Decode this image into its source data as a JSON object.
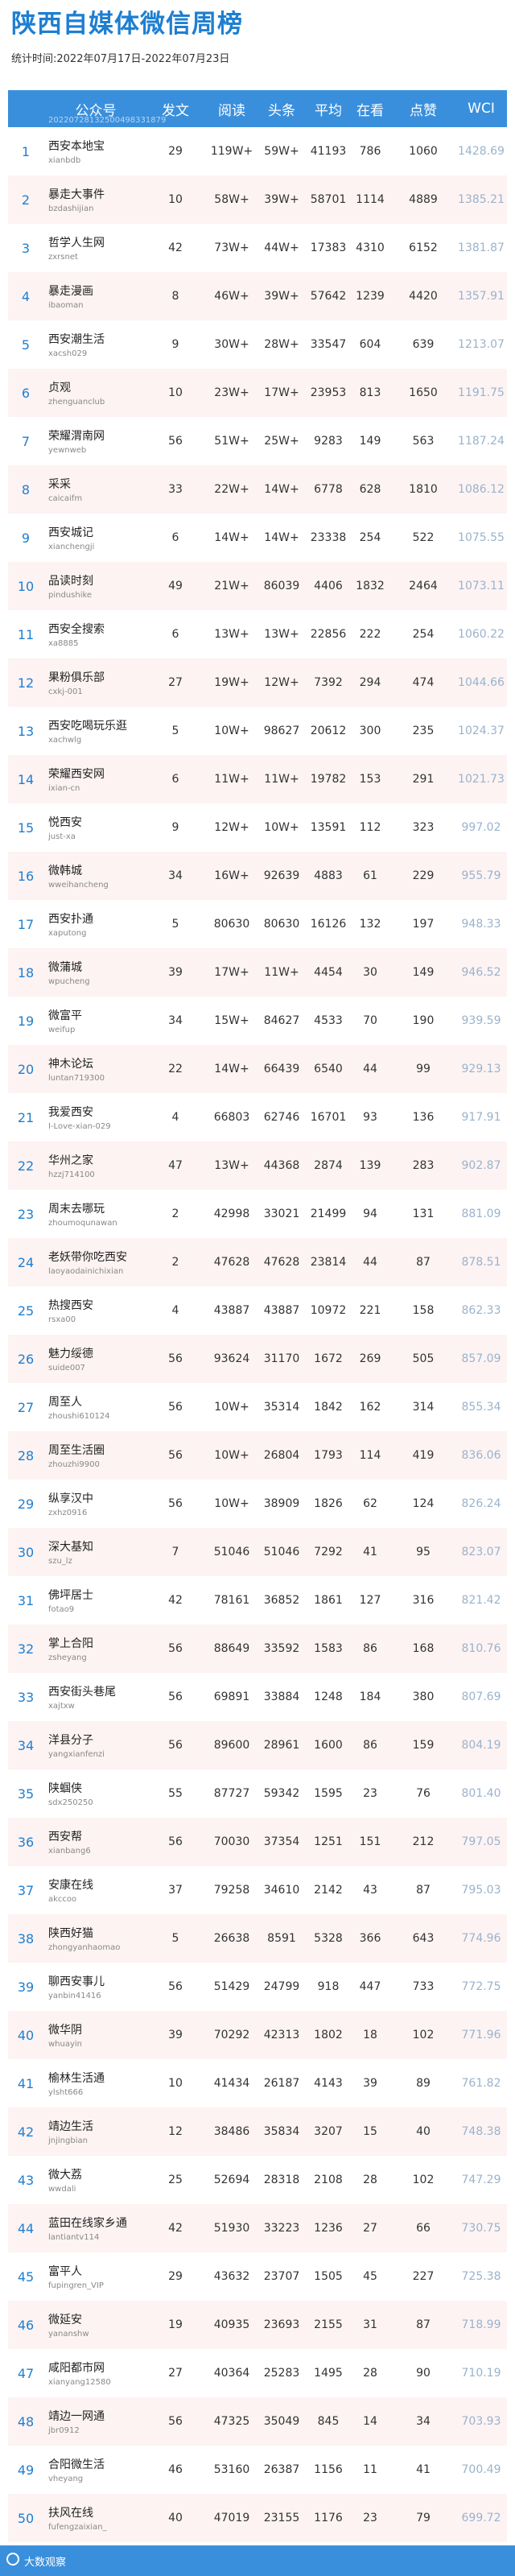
{
  "title": "陕西自媒体微信周榜",
  "period": "统计时间:2022年07月17日-2022年07月23日",
  "table": {
    "headers": {
      "name": "公众号",
      "articles": "发文",
      "reads": "阅读",
      "headline": "头条",
      "average": "平均",
      "watching": "在看",
      "likes": "点赞",
      "wci": "WCI"
    },
    "header_sub": "20220728132500498331879",
    "rows": [
      {
        "rank": "1",
        "name": "西安本地宝",
        "id": "xianbdb",
        "articles": "29",
        "reads": "119W+",
        "headline": "59W+",
        "average": "41193",
        "watching": "786",
        "likes": "1060",
        "wci": "1428.69"
      },
      {
        "rank": "2",
        "name": "暴走大事件",
        "id": "bzdashijian",
        "articles": "10",
        "reads": "58W+",
        "headline": "39W+",
        "average": "58701",
        "watching": "1114",
        "likes": "4889",
        "wci": "1385.21"
      },
      {
        "rank": "3",
        "name": "哲学人生网",
        "id": "zxrsnet",
        "articles": "42",
        "reads": "73W+",
        "headline": "44W+",
        "average": "17383",
        "watching": "4310",
        "likes": "6152",
        "wci": "1381.87"
      },
      {
        "rank": "4",
        "name": "暴走漫画",
        "id": "ibaoman",
        "articles": "8",
        "reads": "46W+",
        "headline": "39W+",
        "average": "57642",
        "watching": "1239",
        "likes": "4420",
        "wci": "1357.91"
      },
      {
        "rank": "5",
        "name": "西安潮生活",
        "id": "xacsh029",
        "articles": "9",
        "reads": "30W+",
        "headline": "28W+",
        "average": "33547",
        "watching": "604",
        "likes": "639",
        "wci": "1213.07"
      },
      {
        "rank": "6",
        "name": "贞观",
        "id": "zhenguanclub",
        "articles": "10",
        "reads": "23W+",
        "headline": "17W+",
        "average": "23953",
        "watching": "813",
        "likes": "1650",
        "wci": "1191.75"
      },
      {
        "rank": "7",
        "name": "荣耀渭南网",
        "id": "yewnweb",
        "articles": "56",
        "reads": "51W+",
        "headline": "25W+",
        "average": "9283",
        "watching": "149",
        "likes": "563",
        "wci": "1187.24"
      },
      {
        "rank": "8",
        "name": "采采",
        "id": "caicaifm",
        "articles": "33",
        "reads": "22W+",
        "headline": "14W+",
        "average": "6778",
        "watching": "628",
        "likes": "1810",
        "wci": "1086.12"
      },
      {
        "rank": "9",
        "name": "西安城记",
        "id": "xianchengji",
        "articles": "6",
        "reads": "14W+",
        "headline": "14W+",
        "average": "23338",
        "watching": "254",
        "likes": "522",
        "wci": "1075.55"
      },
      {
        "rank": "10",
        "name": "品读时刻",
        "id": "pindushike",
        "articles": "49",
        "reads": "21W+",
        "headline": "86039",
        "average": "4406",
        "watching": "1832",
        "likes": "2464",
        "wci": "1073.11"
      },
      {
        "rank": "11",
        "name": "西安全搜索",
        "id": "xa8885",
        "articles": "6",
        "reads": "13W+",
        "headline": "13W+",
        "average": "22856",
        "watching": "222",
        "likes": "254",
        "wci": "1060.22"
      },
      {
        "rank": "12",
        "name": "果粉俱乐部",
        "id": "cxkj-001",
        "articles": "27",
        "reads": "19W+",
        "headline": "12W+",
        "average": "7392",
        "watching": "294",
        "likes": "474",
        "wci": "1044.66"
      },
      {
        "rank": "13",
        "name": "西安吃喝玩乐逛",
        "id": "xachwlg",
        "articles": "5",
        "reads": "10W+",
        "headline": "98627",
        "average": "20612",
        "watching": "300",
        "likes": "235",
        "wci": "1024.37"
      },
      {
        "rank": "14",
        "name": "荣耀西安网",
        "id": "ixian-cn",
        "articles": "6",
        "reads": "11W+",
        "headline": "11W+",
        "average": "19782",
        "watching": "153",
        "likes": "291",
        "wci": "1021.73"
      },
      {
        "rank": "15",
        "name": "悦西安",
        "id": "just-xa",
        "articles": "9",
        "reads": "12W+",
        "headline": "10W+",
        "average": "13591",
        "watching": "112",
        "likes": "323",
        "wci": "997.02"
      },
      {
        "rank": "16",
        "name": "微韩城",
        "id": "wweihancheng",
        "articles": "34",
        "reads": "16W+",
        "headline": "92639",
        "average": "4883",
        "watching": "61",
        "likes": "229",
        "wci": "955.79"
      },
      {
        "rank": "17",
        "name": "西安扑通",
        "id": "xaputong",
        "articles": "5",
        "reads": "80630",
        "headline": "80630",
        "average": "16126",
        "watching": "132",
        "likes": "197",
        "wci": "948.33"
      },
      {
        "rank": "18",
        "name": "微蒲城",
        "id": "wpucheng",
        "articles": "39",
        "reads": "17W+",
        "headline": "11W+",
        "average": "4454",
        "watching": "30",
        "likes": "149",
        "wci": "946.52"
      },
      {
        "rank": "19",
        "name": "微富平",
        "id": "weifup",
        "articles": "34",
        "reads": "15W+",
        "headline": "84627",
        "average": "4533",
        "watching": "70",
        "likes": "190",
        "wci": "939.59"
      },
      {
        "rank": "20",
        "name": "神木论坛",
        "id": "luntan719300",
        "articles": "22",
        "reads": "14W+",
        "headline": "66439",
        "average": "6540",
        "watching": "44",
        "likes": "99",
        "wci": "929.13"
      },
      {
        "rank": "21",
        "name": "我爱西安",
        "id": "I-Love-xian-029",
        "articles": "4",
        "reads": "66803",
        "headline": "62746",
        "average": "16701",
        "watching": "93",
        "likes": "136",
        "wci": "917.91"
      },
      {
        "rank": "22",
        "name": "华州之家",
        "id": "hzzj714100",
        "articles": "47",
        "reads": "13W+",
        "headline": "44368",
        "average": "2874",
        "watching": "139",
        "likes": "283",
        "wci": "902.87"
      },
      {
        "rank": "23",
        "name": "周末去哪玩",
        "id": "zhoumoqunawan",
        "articles": "2",
        "reads": "42998",
        "headline": "33021",
        "average": "21499",
        "watching": "94",
        "likes": "131",
        "wci": "881.09"
      },
      {
        "rank": "24",
        "name": "老妖带你吃西安",
        "id": "laoyaodainichixian",
        "articles": "2",
        "reads": "47628",
        "headline": "47628",
        "average": "23814",
        "watching": "44",
        "likes": "87",
        "wci": "878.51"
      },
      {
        "rank": "25",
        "name": "热搜西安",
        "id": "rsxa00",
        "articles": "4",
        "reads": "43887",
        "headline": "43887",
        "average": "10972",
        "watching": "221",
        "likes": "158",
        "wci": "862.33"
      },
      {
        "rank": "26",
        "name": "魅力绥德",
        "id": "suide007",
        "articles": "56",
        "reads": "93624",
        "headline": "31170",
        "average": "1672",
        "watching": "269",
        "likes": "505",
        "wci": "857.09"
      },
      {
        "rank": "27",
        "name": "周至人",
        "id": "zhoushi610124",
        "articles": "56",
        "reads": "10W+",
        "headline": "35314",
        "average": "1842",
        "watching": "162",
        "likes": "314",
        "wci": "855.34"
      },
      {
        "rank": "28",
        "name": "周至生活圈",
        "id": "zhouzhi9900",
        "articles": "56",
        "reads": "10W+",
        "headline": "26804",
        "average": "1793",
        "watching": "114",
        "likes": "419",
        "wci": "836.06"
      },
      {
        "rank": "29",
        "name": "纵享汉中",
        "id": "zxhz0916",
        "articles": "56",
        "reads": "10W+",
        "headline": "38909",
        "average": "1826",
        "watching": "62",
        "likes": "124",
        "wci": "826.24"
      },
      {
        "rank": "30",
        "name": "深大基知",
        "id": "szu_lz",
        "articles": "7",
        "reads": "51046",
        "headline": "51046",
        "average": "7292",
        "watching": "41",
        "likes": "95",
        "wci": "823.07"
      },
      {
        "rank": "31",
        "name": "佛坪居士",
        "id": "fotao9",
        "articles": "42",
        "reads": "78161",
        "headline": "36852",
        "average": "1861",
        "watching": "127",
        "likes": "316",
        "wci": "821.42"
      },
      {
        "rank": "32",
        "name": "掌上合阳",
        "id": "zsheyang",
        "articles": "56",
        "reads": "88649",
        "headline": "33592",
        "average": "1583",
        "watching": "86",
        "likes": "168",
        "wci": "810.76"
      },
      {
        "rank": "33",
        "name": "西安街头巷尾",
        "id": "xajtxw",
        "articles": "56",
        "reads": "69891",
        "headline": "33884",
        "average": "1248",
        "watching": "184",
        "likes": "380",
        "wci": "807.69"
      },
      {
        "rank": "34",
        "name": "洋县分子",
        "id": "yangxianfenzi",
        "articles": "56",
        "reads": "89600",
        "headline": "28961",
        "average": "1600",
        "watching": "86",
        "likes": "159",
        "wci": "804.19"
      },
      {
        "rank": "35",
        "name": "陕蝈侠",
        "id": "sdx250250",
        "articles": "55",
        "reads": "87727",
        "headline": "59342",
        "average": "1595",
        "watching": "23",
        "likes": "76",
        "wci": "801.40"
      },
      {
        "rank": "36",
        "name": "西安帮",
        "id": "xianbang6",
        "articles": "56",
        "reads": "70030",
        "headline": "37354",
        "average": "1251",
        "watching": "151",
        "likes": "212",
        "wci": "797.05"
      },
      {
        "rank": "37",
        "name": "安康在线",
        "id": "akccoo",
        "articles": "37",
        "reads": "79258",
        "headline": "34610",
        "average": "2142",
        "watching": "43",
        "likes": "87",
        "wci": "795.03"
      },
      {
        "rank": "38",
        "name": "陕西好猫",
        "id": "zhongyanhaomao",
        "articles": "5",
        "reads": "26638",
        "headline": "8591",
        "average": "5328",
        "watching": "366",
        "likes": "643",
        "wci": "774.96"
      },
      {
        "rank": "39",
        "name": "聊西安事儿",
        "id": "yanbin41416",
        "articles": "56",
        "reads": "51429",
        "headline": "24799",
        "average": "918",
        "watching": "447",
        "likes": "733",
        "wci": "772.75"
      },
      {
        "rank": "40",
        "name": "微华阴",
        "id": "whuayin",
        "articles": "39",
        "reads": "70292",
        "headline": "42313",
        "average": "1802",
        "watching": "18",
        "likes": "102",
        "wci": "771.96"
      },
      {
        "rank": "41",
        "name": "榆林生活通",
        "id": "ylsht666",
        "articles": "10",
        "reads": "41434",
        "headline": "26187",
        "average": "4143",
        "watching": "39",
        "likes": "89",
        "wci": "761.82"
      },
      {
        "rank": "42",
        "name": "靖边生活",
        "id": "jnjingbian",
        "articles": "12",
        "reads": "38486",
        "headline": "35834",
        "average": "3207",
        "watching": "15",
        "likes": "40",
        "wci": "748.38"
      },
      {
        "rank": "43",
        "name": "微大荔",
        "id": "wwdali",
        "articles": "25",
        "reads": "52694",
        "headline": "28318",
        "average": "2108",
        "watching": "28",
        "likes": "102",
        "wci": "747.29"
      },
      {
        "rank": "44",
        "name": "蓝田在线家乡通",
        "id": "lantiantv114",
        "articles": "42",
        "reads": "51930",
        "headline": "33223",
        "average": "1236",
        "watching": "27",
        "likes": "66",
        "wci": "730.75"
      },
      {
        "rank": "45",
        "name": "富平人",
        "id": "fupingren_VIP",
        "articles": "29",
        "reads": "43632",
        "headline": "23707",
        "average": "1505",
        "watching": "45",
        "likes": "227",
        "wci": "725.38"
      },
      {
        "rank": "46",
        "name": "微延安",
        "id": "yananshw",
        "articles": "19",
        "reads": "40935",
        "headline": "23693",
        "average": "2155",
        "watching": "31",
        "likes": "87",
        "wci": "718.99"
      },
      {
        "rank": "47",
        "name": "咸阳都市网",
        "id": "xianyang12580",
        "articles": "27",
        "reads": "40364",
        "headline": "25283",
        "average": "1495",
        "watching": "28",
        "likes": "90",
        "wci": "710.19"
      },
      {
        "rank": "48",
        "name": "靖边一网通",
        "id": "jbr0912",
        "articles": "56",
        "reads": "47325",
        "headline": "35049",
        "average": "845",
        "watching": "14",
        "likes": "34",
        "wci": "703.93"
      },
      {
        "rank": "49",
        "name": "合阳微生活",
        "id": "vheyang",
        "articles": "46",
        "reads": "53160",
        "headline": "26387",
        "average": "1156",
        "watching": "11",
        "likes": "41",
        "wci": "700.49"
      },
      {
        "rank": "50",
        "name": "扶风在线",
        "id": "fufengzaixian_",
        "articles": "40",
        "reads": "47019",
        "headline": "23155",
        "average": "1176",
        "watching": "23",
        "likes": "79",
        "wci": "699.72"
      }
    ]
  },
  "footer": {
    "text": "大数观察"
  }
}
